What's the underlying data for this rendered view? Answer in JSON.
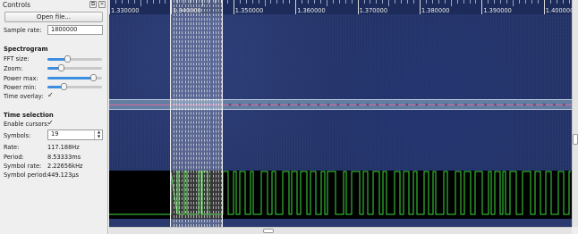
{
  "panel": {
    "title": "Controls",
    "float_icon": "⧉",
    "close_icon": "×",
    "open_file_label": "Open file...",
    "sample_rate_label": "Sample rate:",
    "sample_rate_value": "1800000",
    "spectrogram_header": "Spectrogram",
    "fft_size_label": "FFT size:",
    "zoom_label": "Zoom:",
    "power_max_label": "Power max:",
    "power_min_label": "Power min:",
    "time_overlay_label": "Time overlay:",
    "time_selection_header": "Time selection",
    "enable_cursors_label": "Enable cursors:",
    "symbols_label": "Symbols:",
    "symbols_value": "19",
    "rate_label": "Rate:",
    "rate_value": "117.188Hz",
    "period_label": "Period:",
    "period_value": "8.53333ms",
    "symbol_rate_label": "Symbol rate:",
    "symbol_rate_value": "2.22656kHz",
    "symbol_period_label": "Symbol period:",
    "symbol_period_value": "449.123µs",
    "check_mark": "✓",
    "spin_up": "▲",
    "spin_down": "▼"
  },
  "sliders": {
    "fft_size": 0.36,
    "zoom": 0.22,
    "power_max": 0.88,
    "power_min": 0.28
  },
  "checks": {
    "time_overlay": true,
    "enable_cursors": true
  },
  "axis": {
    "ticks": [
      "1.330000",
      "1.340000",
      "1.350000",
      "1.360000",
      "1.370000",
      "1.380000",
      "1.390000",
      "1.400000"
    ]
  },
  "colors": {
    "accent": "#3d8ee0",
    "spectrogram_bg": "#25356b",
    "signal": "#3ddc3d",
    "band": "#6a86a8"
  }
}
